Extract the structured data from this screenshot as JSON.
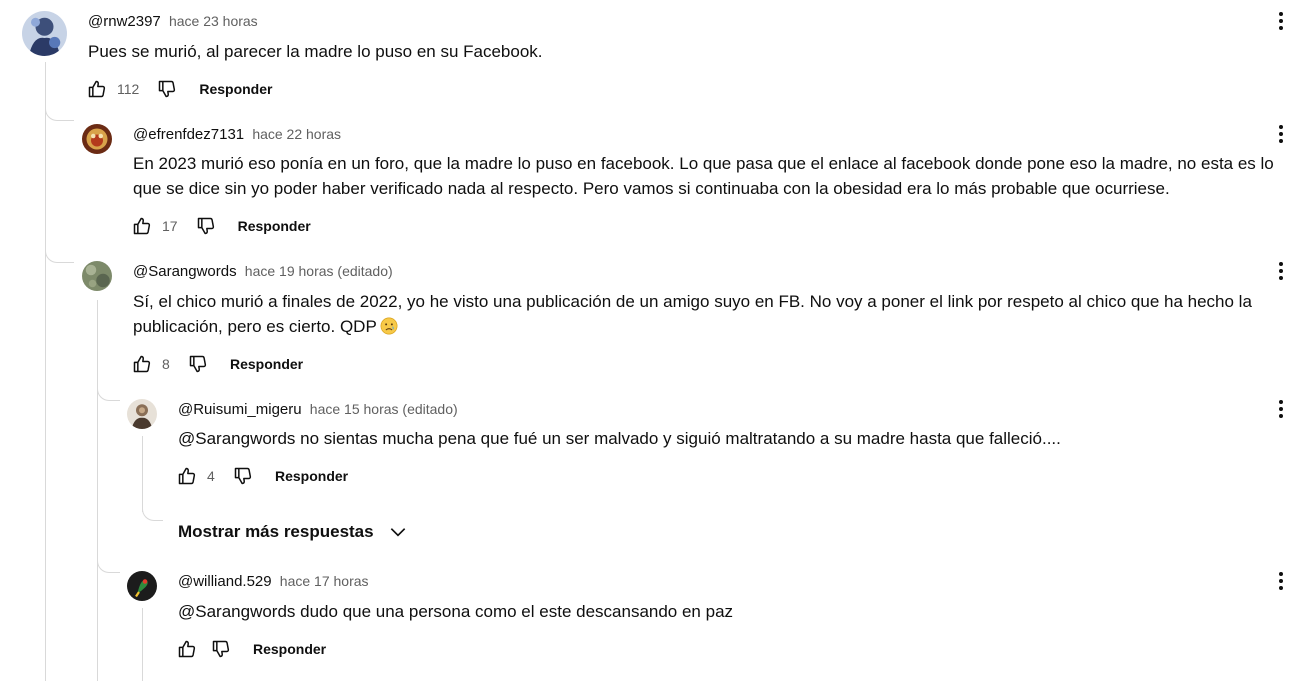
{
  "comments": [
    {
      "author": "@rnw2397",
      "time": "hace 23 horas",
      "text": "Pues se murió, al parecer la madre lo puso en su Facebook.",
      "likes": "112",
      "reply_label": "Responder",
      "avatar_icon": "user-avatar"
    },
    {
      "author": "@efrenfdez7131",
      "time": "hace 22 horas",
      "text": "En 2023 murió eso ponía en un foro, que la madre lo puso en facebook. Lo que pasa que el enlace al facebook donde pone eso la madre, no esta es lo que se dice sin yo poder haber verificado nada al respecto. Pero vamos si continuaba con la obesidad era lo más probable que ocurriese.",
      "likes": "17",
      "reply_label": "Responder",
      "avatar_icon": "user-avatar"
    },
    {
      "author": "@Sarangwords",
      "time": "hace 19 horas (editado)",
      "text": "Sí, el chico murió a finales de 2022, yo he visto una publicación de un amigo suyo en FB. No voy a poner el link por respeto al chico que ha hecho la publicación, pero es cierto. QDP",
      "emoji": "crying-face-emoji",
      "likes": "8",
      "reply_label": "Responder",
      "avatar_icon": "user-avatar"
    },
    {
      "author": "@Ruisumi_migeru",
      "time": "hace 15 horas (editado)",
      "text": "@Sarangwords no sientas mucha pena que fué un ser malvado y siguió maltratando a su madre hasta que falleció....",
      "likes": "4",
      "reply_label": "Responder",
      "avatar_icon": "user-avatar"
    },
    {
      "author": "@williand.529",
      "time": "hace 17 horas",
      "text": "@Sarangwords dudo que una persona como el este descansando en paz",
      "likes": "",
      "reply_label": "Responder",
      "avatar_icon": "user-avatar"
    }
  ],
  "show_more_replies": "Mostrar más respuestas",
  "icons": {
    "like": "thumbs-up-icon",
    "dislike": "thumbs-down-icon",
    "more": "more-vert-icon",
    "chevron": "chevron-down-icon"
  }
}
